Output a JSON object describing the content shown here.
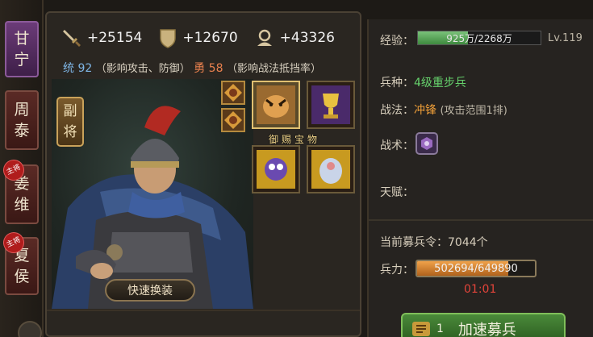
{
  "generals_tabs": [
    {
      "name": "甘宁",
      "chars": [
        "甘",
        "宁"
      ],
      "style": "purple",
      "main": false
    },
    {
      "name": "周泰",
      "chars": [
        "周",
        "泰"
      ],
      "style": "maroon",
      "main": false
    },
    {
      "name": "姜维",
      "chars": [
        "姜",
        "维"
      ],
      "style": "maroon",
      "main": true
    },
    {
      "name": "夏侯",
      "chars": [
        "夏",
        "侯"
      ],
      "style": "maroon",
      "main": true
    }
  ],
  "main_badge_text": "主将",
  "stats": {
    "attack": "+25154",
    "defense": "+12670",
    "troops": "+43326"
  },
  "attributes": {
    "tong_label": "统",
    "tong_value": "92",
    "tong_note": "（影响攻击、防御）",
    "yong_label": "勇",
    "yong_value": "58",
    "yong_note": "（影响战法抵挡率）"
  },
  "deputy_label": [
    "副",
    "将"
  ],
  "swap_button": "快速换装",
  "treasure_label": "御赐宝物",
  "info": {
    "exp_label": "经验：",
    "exp_text": "925万/2268万",
    "exp_fraction": 0.408,
    "level": "Lv.119",
    "unit_label": "兵种：",
    "unit_value": "4级重步兵",
    "tactic_label": "战法：",
    "tactic_value": "冲锋",
    "tactic_note": "(攻击范围1排)",
    "art_label": "战术：",
    "talent_label": "天赋：",
    "recruit_label": "当前募兵令：",
    "recruit_value": "7044个",
    "strength_label": "兵力：",
    "strength_text": "502694/649890",
    "strength_fraction": 0.773,
    "timer": "01:01",
    "accel_qty": "1",
    "accel_button": "加速募兵"
  },
  "colors": {
    "accent_green": "#66d26c",
    "accent_orange": "#f1a039",
    "timer_red": "#e3443a"
  }
}
